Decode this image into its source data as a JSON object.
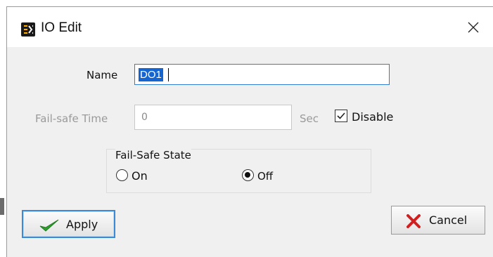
{
  "window": {
    "title": "IO Edit",
    "close_glyph": "✕"
  },
  "form": {
    "name_label": "Name",
    "name_value": "DO1",
    "failsafe_time_label": "Fail-safe Time",
    "failsafe_time_value": "0",
    "failsafe_time_unit": "Sec",
    "disable_label": "Disable",
    "disable_checked": true
  },
  "failsafe_state": {
    "group_title": "Fail-Safe State",
    "options": [
      {
        "label": "On",
        "selected": false
      },
      {
        "label": "Off",
        "selected": true
      }
    ]
  },
  "buttons": {
    "apply_label": "Apply",
    "cancel_label": "Cancel"
  },
  "colors": {
    "accent": "#1464d2",
    "apply_check": "#2e9e2e",
    "cancel_x": "#d21e1e",
    "disabled_text": "#9a9a9a"
  },
  "icons": {
    "app": "io-edit-app-icon",
    "close": "close-icon",
    "apply": "green-checkmark-icon",
    "cancel": "red-x-icon"
  }
}
